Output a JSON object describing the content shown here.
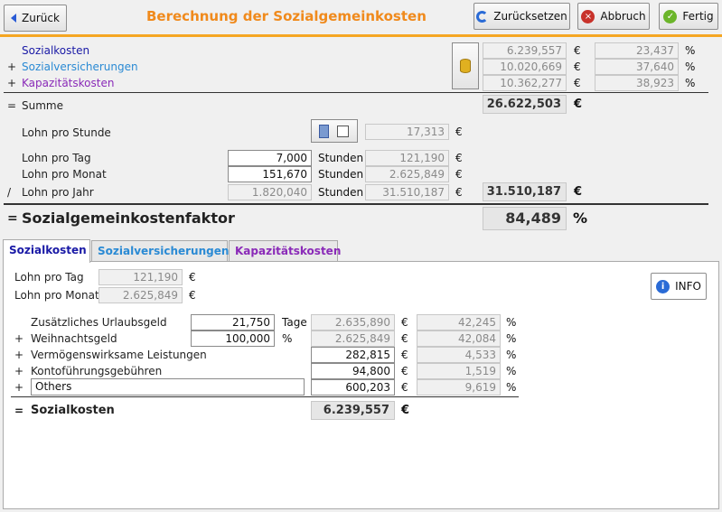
{
  "header": {
    "title": "Berechnung der Sozialgemeinkosten",
    "back_label": "Zurück",
    "reset_label": "Zurücksetzen",
    "cancel_label": "Abbruch",
    "done_label": "Fertig"
  },
  "summary": {
    "sozialkosten": {
      "label": "Sozialkosten",
      "value": "6.239,557",
      "unit": "€",
      "pct": "23,437",
      "pct_unit": "%"
    },
    "sozialversicherungen": {
      "op": "+",
      "label": "Sozialversicherungen",
      "value": "10.020,669",
      "unit": "€",
      "pct": "37,640",
      "pct_unit": "%"
    },
    "kapazitaet": {
      "op": "+",
      "label": "Kapazitätskosten",
      "value": "10.362,277",
      "unit": "€",
      "pct": "38,923",
      "pct_unit": "%"
    },
    "summe": {
      "op": "=",
      "label": "Summe",
      "value": "26.622,503",
      "unit": "€"
    },
    "lohn_stunde": {
      "label": "Lohn pro Stunde",
      "value": "17,313",
      "unit": "€"
    },
    "lohn_tag": {
      "label": "Lohn pro Tag",
      "input": "7,000",
      "input_unit": "Stunden",
      "value": "121,190",
      "unit": "€"
    },
    "lohn_monat": {
      "label": "Lohn pro Monat",
      "input": "151,670",
      "input_unit": "Stunden",
      "value": "2.625,849",
      "unit": "€"
    },
    "lohn_jahr": {
      "op": "/",
      "label": "Lohn pro Jahr",
      "input": "1.820,040",
      "input_unit": "Stunden",
      "value": "31.510,187",
      "unit": "€",
      "total": "31.510,187",
      "total_unit": "€"
    },
    "faktor": {
      "op": "=",
      "label": "Sozialgemeinkostenfaktor",
      "value": "84,489",
      "unit": "%"
    }
  },
  "tabs": [
    {
      "label": "Sozialkosten",
      "color": "#1a1aa6",
      "active": true
    },
    {
      "label": "Sozialversicherungen",
      "color": "#2a8ad4",
      "active": false
    },
    {
      "label": "Kapazitätskosten",
      "color": "#8a2ab8",
      "active": false
    }
  ],
  "panel": {
    "lohn_tag": {
      "label": "Lohn pro Tag",
      "value": "121,190",
      "unit": "€"
    },
    "lohn_monat": {
      "label": "Lohn pro Monat",
      "value": "2.625,849",
      "unit": "€"
    },
    "info_label": "INFO",
    "rows": [
      {
        "op": "",
        "label": "Zusätzliches Urlaubsgeld",
        "input": "21,750",
        "input_unit": "Tage",
        "value": "2.635,890",
        "unit": "€",
        "pct": "42,245",
        "pct_unit": "%"
      },
      {
        "op": "+",
        "label": "Weihnachtsgeld",
        "input": "100,000",
        "input_unit": "%",
        "value": "2.625,849",
        "unit": "€",
        "pct": "42,084",
        "pct_unit": "%"
      },
      {
        "op": "+",
        "label": "Vermögenswirksame Leistungen",
        "value": "282,815",
        "unit": "€",
        "pct": "4,533",
        "pct_unit": "%"
      },
      {
        "op": "+",
        "label": "Kontoführungsgebühren",
        "value": "94,800",
        "unit": "€",
        "pct": "1,519",
        "pct_unit": "%"
      },
      {
        "op": "+",
        "label": "Others",
        "value": "600,203",
        "unit": "€",
        "pct": "9,619",
        "pct_unit": "%"
      }
    ],
    "total": {
      "op": "=",
      "label": "Sozialkosten",
      "value": "6.239,557",
      "unit": "€"
    }
  }
}
